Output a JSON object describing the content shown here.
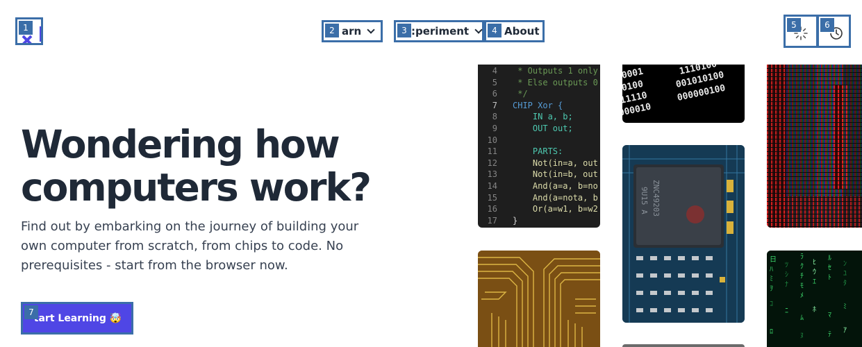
{
  "header": {
    "logo_marker": "1",
    "nav": [
      {
        "marker": "2",
        "label": "arn"
      },
      {
        "marker": "3",
        "label": ":periment"
      },
      {
        "marker": "4",
        "label": "About"
      }
    ],
    "theme_marker": "5",
    "history_marker": "6"
  },
  "hero": {
    "title": "Wondering how computers work?",
    "subtitle": "Find out by embarking on the journey of building your own computer from scratch, from chips to code. No prerequisites - start from the browser now.",
    "cta_marker": "7",
    "cta_label": "tart Learning 🤯"
  },
  "code_sample": {
    "lines": [
      {
        "n": "4",
        "text": " * Outputs 1 only"
      },
      {
        "n": "5",
        "text": " * Else outputs 0"
      },
      {
        "n": "6",
        "text": " */"
      },
      {
        "n": "7",
        "text": "CHIP Xor {"
      },
      {
        "n": "8",
        "text": "    IN a, b;"
      },
      {
        "n": "9",
        "text": "    OUT out;"
      },
      {
        "n": "10",
        "text": ""
      },
      {
        "n": "11",
        "text": "    PARTS:"
      },
      {
        "n": "12",
        "text": "    Not(in=a, out"
      },
      {
        "n": "13",
        "text": "    Not(in=b, out"
      },
      {
        "n": "14",
        "text": "    And(a=a, b=no"
      },
      {
        "n": "15",
        "text": "    And(a=nota, b"
      },
      {
        "n": "16",
        "text": "    Or(a=w1, b=w2"
      },
      {
        "n": "17",
        "text": "}"
      }
    ]
  },
  "binary_image": {
    "rows": [
      "1110100",
      "001010100",
      "000000100",
      "0001",
      "0100",
      "11110",
      "000010"
    ]
  },
  "colors": {
    "accent": "#4f46e5",
    "text": "#1f2937",
    "marker": "#3b6ea8"
  }
}
